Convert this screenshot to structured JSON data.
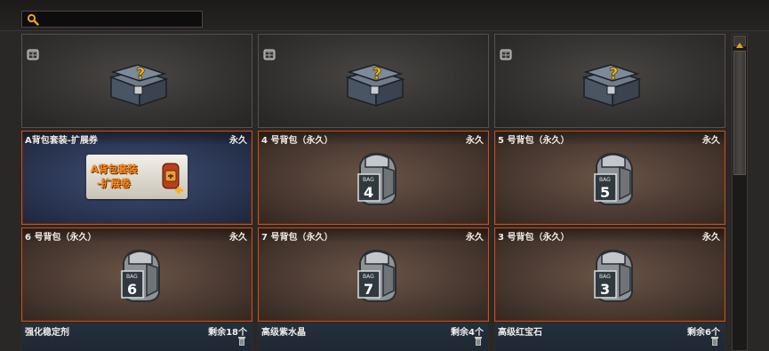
{
  "search": {
    "value": "",
    "placeholder": ""
  },
  "header_row": [
    {
      "icon": "chest-icon"
    },
    {
      "icon": "chest-icon"
    },
    {
      "icon": "chest-icon"
    }
  ],
  "items": [
    {
      "name": "A背包套装-扩展券",
      "duration": "永久",
      "icon": "expansion-coupon-icon",
      "promo_line1": "A背包套装",
      "promo_line2": "-扩展卷"
    },
    {
      "name": "4 号背包（永久）",
      "duration": "永久",
      "icon": "bag-icon",
      "bag_label": "BAG",
      "bag_number": "4"
    },
    {
      "name": "5 号背包（永久）",
      "duration": "永久",
      "icon": "bag-icon",
      "bag_label": "BAG",
      "bag_number": "5"
    },
    {
      "name": "6 号背包（永久）",
      "duration": "永久",
      "icon": "bag-icon",
      "bag_label": "BAG",
      "bag_number": "6"
    },
    {
      "name": "7 号背包（永久）",
      "duration": "永久",
      "icon": "bag-icon",
      "bag_label": "BAG",
      "bag_number": "7"
    },
    {
      "name": "3 号背包（永久）",
      "duration": "永久",
      "icon": "bag-icon",
      "bag_label": "BAG",
      "bag_number": "3"
    }
  ],
  "bottom_row": [
    {
      "name": "强化稳定剂",
      "remaining": "剩余18个"
    },
    {
      "name": "高级紫水晶",
      "remaining": "剩余4个"
    },
    {
      "name": "高级红宝石",
      "remaining": "剩余6个"
    }
  ],
  "colors": {
    "accent_border": "#c2521e",
    "promo_text": "#ff8a1d"
  }
}
